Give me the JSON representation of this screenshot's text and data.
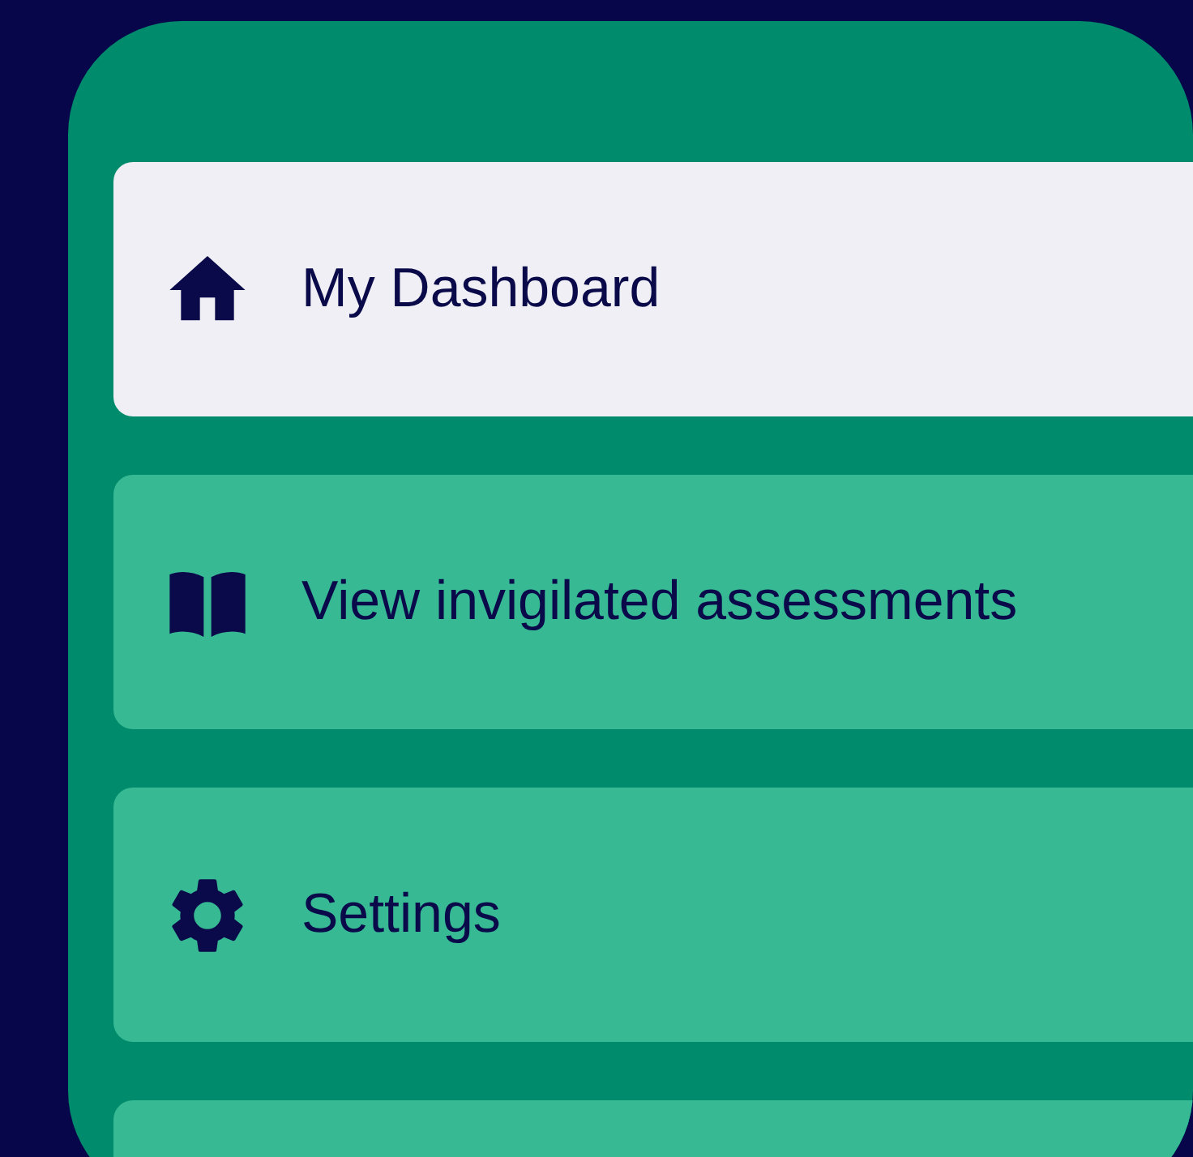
{
  "menu": {
    "items": [
      {
        "kind": "home",
        "label": "My Dashboard",
        "selected": true
      },
      {
        "kind": "book",
        "label": "View invigilated assessments",
        "selected": false
      },
      {
        "kind": "settings",
        "label": "Settings",
        "selected": false
      }
    ]
  }
}
